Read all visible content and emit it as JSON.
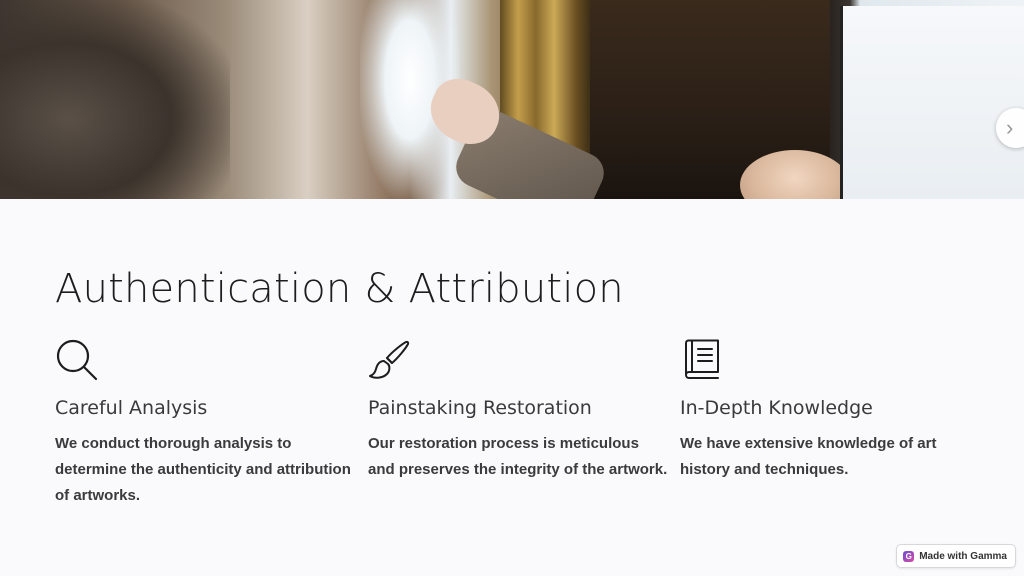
{
  "hero": {
    "image_alt": "Art conservator examining a gilded painting"
  },
  "nav": {
    "next_icon": "chevron-right-icon",
    "next_glyph": "›"
  },
  "section": {
    "title": "Authentication & Attribution"
  },
  "features": [
    {
      "icon": "search-icon",
      "heading": "Careful Analysis",
      "body": "We conduct thorough analysis to determine the authenticity and attribution of artworks."
    },
    {
      "icon": "paintbrush-icon",
      "heading": "Painstaking Restoration",
      "body": "Our restoration process is meticulous and preserves the integrity of the artwork."
    },
    {
      "icon": "book-icon",
      "heading": "In-Depth Knowledge",
      "body": "We have extensive knowledge of art history and techniques."
    }
  ],
  "badge": {
    "label": "Made with Gamma",
    "logo_glyph": "G"
  },
  "colors": {
    "background": "#fafafc",
    "text": "#1d1d1f",
    "body_text": "#3b3b3d"
  }
}
